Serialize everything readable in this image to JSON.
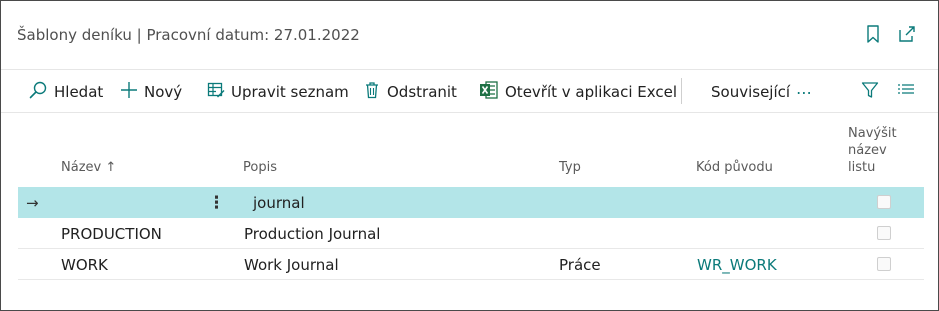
{
  "header": {
    "title": "Šablony deníku | Pracovní datum: 27.01.2022",
    "icons": [
      "bookmark-icon",
      "open-new-window-icon"
    ]
  },
  "toolbar": {
    "search_label": "Hledat",
    "new_label": "Nový",
    "edit_list_label": "Upravit seznam",
    "delete_label": "Odstranit",
    "excel_label": "Otevřít v aplikaci Excel",
    "related_label": "Související",
    "more_label": "⋯"
  },
  "table": {
    "columns": {
      "name": "Název",
      "description": "Popis",
      "type": "Typ",
      "source_code": "Kód původu",
      "increment_line1": "Navýšit",
      "increment_line2": "název",
      "increment_line3": "listu"
    },
    "sort_indicator": "↑",
    "rows": [
      {
        "name": "",
        "description": "journal",
        "type": "",
        "source_code": "",
        "increment": false,
        "selected": true
      },
      {
        "name": "PRODUCTION",
        "description": "Production Journal",
        "type": "",
        "source_code": "",
        "increment": false,
        "selected": false
      },
      {
        "name": "WORK",
        "description": "Work Journal",
        "type": "Práce",
        "source_code": "WR_WORK",
        "increment": false,
        "selected": false
      }
    ],
    "row_arrow": "→",
    "row_menu": "⋮"
  },
  "colors": {
    "accent": "#0b7a7a",
    "selected_row": "#b3e5e8",
    "excel_green": "#1e7145"
  }
}
